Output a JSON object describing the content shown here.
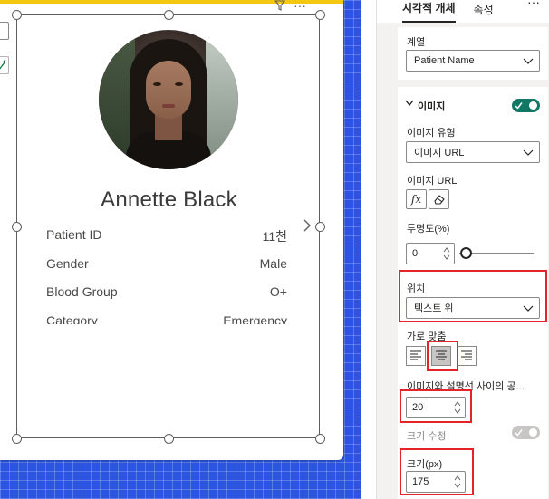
{
  "card": {
    "name": "Annette Black",
    "fields": [
      {
        "label": "Patient ID",
        "value": "11천"
      },
      {
        "label": "Gender",
        "value": "Male"
      },
      {
        "label": "Blood Group",
        "value": "O+"
      },
      {
        "label": "Category",
        "value": "Emergency"
      }
    ]
  },
  "pane": {
    "tabs": [
      "시각적 개체",
      "속성"
    ],
    "more": "···",
    "series_label": "계열",
    "series_value": "Patient Name",
    "image_section_title": "이미지",
    "image_toggle": "on",
    "image_type_label": "이미지 유형",
    "image_type_value": "이미지 URL",
    "image_url_label": "이미지 URL",
    "fx_label": "fx",
    "transparency_label": "투명도(%)",
    "transparency_value": "0",
    "position_label": "위치",
    "position_value": "텍스트 위",
    "horizontal_align_label": "가로 맞춤",
    "horizontal_align_selected": "center",
    "spacing_label": "이미지와 설명선 사이의 공...",
    "spacing_value": "20",
    "custom_size_label": "크기 수정",
    "custom_size_toggle": "off",
    "size_label": "크기(px)",
    "size_value": "175"
  },
  "colors": {
    "canvas_bg": "#2b55e0",
    "accent_yellow": "#f2c811",
    "toggle_on": "#117865",
    "highlight_red": "#e3242b"
  }
}
